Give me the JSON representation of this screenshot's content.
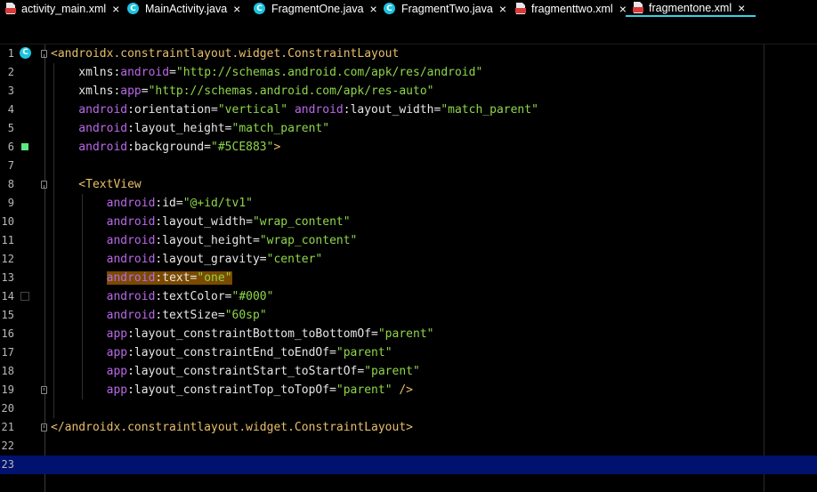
{
  "tabs": [
    {
      "label": "activity_main.xml",
      "type": "xml",
      "active": false
    },
    {
      "label": "MainActivity.java",
      "type": "java",
      "active": false
    },
    {
      "label": "FragmentOne.java",
      "type": "java",
      "active": false
    },
    {
      "label": "FragmentTwo.java",
      "type": "java",
      "active": false
    },
    {
      "label": "fragmenttwo.xml",
      "type": "xml",
      "active": false
    },
    {
      "label": "fragmentone.xml",
      "type": "xml",
      "active": true
    }
  ],
  "tab_close_glyph": "×",
  "java_icon_letter": "C",
  "accent_color": "#3cd0e6",
  "current_line": 23,
  "gutter": {
    "line1_badge": "C",
    "line6_color_swatch": "#5CE883",
    "line14_color_swatch": "#000"
  },
  "lines": [
    {
      "n": "1",
      "tokens": [
        [
          "t-tag",
          "<androidx.constraintlayout.widget.ConstraintLayout"
        ]
      ]
    },
    {
      "n": "2",
      "tokens": [
        [
          "t-plain",
          "    xmlns:"
        ],
        [
          "t-attr",
          "android"
        ],
        [
          "t-plain",
          "="
        ],
        [
          "t-val",
          "\"http://schemas.android.com/apk/res/android\""
        ]
      ]
    },
    {
      "n": "3",
      "tokens": [
        [
          "t-plain",
          "    xmlns:"
        ],
        [
          "t-attr",
          "app"
        ],
        [
          "t-plain",
          "="
        ],
        [
          "t-val",
          "\"http://schemas.android.com/apk/res-auto\""
        ]
      ]
    },
    {
      "n": "4",
      "tokens": [
        [
          "t-attr",
          "    android"
        ],
        [
          "t-plain",
          ":orientation="
        ],
        [
          "t-val",
          "\"vertical\""
        ],
        [
          "t-plain",
          " "
        ],
        [
          "t-attr",
          "android"
        ],
        [
          "t-plain",
          ":layout_width="
        ],
        [
          "t-val",
          "\"match_parent\""
        ]
      ]
    },
    {
      "n": "5",
      "tokens": [
        [
          "t-attr",
          "    android"
        ],
        [
          "t-plain",
          ":layout_height="
        ],
        [
          "t-val",
          "\"match_parent\""
        ]
      ]
    },
    {
      "n": "6",
      "tokens": [
        [
          "t-attr",
          "    android"
        ],
        [
          "t-plain",
          ":background="
        ],
        [
          "t-val",
          "\"#5CE883\""
        ],
        [
          "t-tag",
          ">"
        ]
      ]
    },
    {
      "n": "7",
      "tokens": []
    },
    {
      "n": "8",
      "tokens": [
        [
          "t-tag",
          "    <TextView"
        ]
      ]
    },
    {
      "n": "9",
      "tokens": [
        [
          "t-attr",
          "        android"
        ],
        [
          "t-plain",
          ":id="
        ],
        [
          "t-val",
          "\"@+id/tv1\""
        ]
      ]
    },
    {
      "n": "10",
      "tokens": [
        [
          "t-attr",
          "        android"
        ],
        [
          "t-plain",
          ":layout_width="
        ],
        [
          "t-val",
          "\"wrap_content\""
        ]
      ]
    },
    {
      "n": "11",
      "tokens": [
        [
          "t-attr",
          "        android"
        ],
        [
          "t-plain",
          ":layout_height="
        ],
        [
          "t-val",
          "\"wrap_content\""
        ]
      ]
    },
    {
      "n": "12",
      "tokens": [
        [
          "t-attr",
          "        android"
        ],
        [
          "t-plain",
          ":layout_gravity="
        ],
        [
          "t-val",
          "\"center\""
        ]
      ]
    },
    {
      "n": "13",
      "tokens": [
        [
          "t-plain",
          "        "
        ],
        [
          "hl t-attr",
          "android"
        ],
        [
          "hl t-plain",
          ":text="
        ],
        [
          "hl t-val",
          "\"one\""
        ]
      ]
    },
    {
      "n": "14",
      "tokens": [
        [
          "t-attr",
          "        android"
        ],
        [
          "t-plain",
          ":textColor="
        ],
        [
          "t-val",
          "\"#000\""
        ]
      ]
    },
    {
      "n": "15",
      "tokens": [
        [
          "t-attr",
          "        android"
        ],
        [
          "t-plain",
          ":textSize="
        ],
        [
          "t-val",
          "\"60sp\""
        ]
      ]
    },
    {
      "n": "16",
      "tokens": [
        [
          "t-attr",
          "        app"
        ],
        [
          "t-plain",
          ":layout_constraintBottom_toBottomOf="
        ],
        [
          "t-val",
          "\"parent\""
        ]
      ]
    },
    {
      "n": "17",
      "tokens": [
        [
          "t-attr",
          "        app"
        ],
        [
          "t-plain",
          ":layout_constraintEnd_toEndOf="
        ],
        [
          "t-val",
          "\"parent\""
        ]
      ]
    },
    {
      "n": "18",
      "tokens": [
        [
          "t-attr",
          "        app"
        ],
        [
          "t-plain",
          ":layout_constraintStart_toStartOf="
        ],
        [
          "t-val",
          "\"parent\""
        ]
      ]
    },
    {
      "n": "19",
      "tokens": [
        [
          "t-attr",
          "        app"
        ],
        [
          "t-plain",
          ":layout_constraintTop_toTopOf="
        ],
        [
          "t-val",
          "\"parent\""
        ],
        [
          "t-tag",
          " />"
        ]
      ]
    },
    {
      "n": "20",
      "tokens": []
    },
    {
      "n": "21",
      "tokens": [
        [
          "t-tag",
          "</androidx.constraintlayout.widget.ConstraintLayout>"
        ]
      ]
    },
    {
      "n": "22",
      "tokens": []
    },
    {
      "n": "23",
      "tokens": []
    }
  ]
}
